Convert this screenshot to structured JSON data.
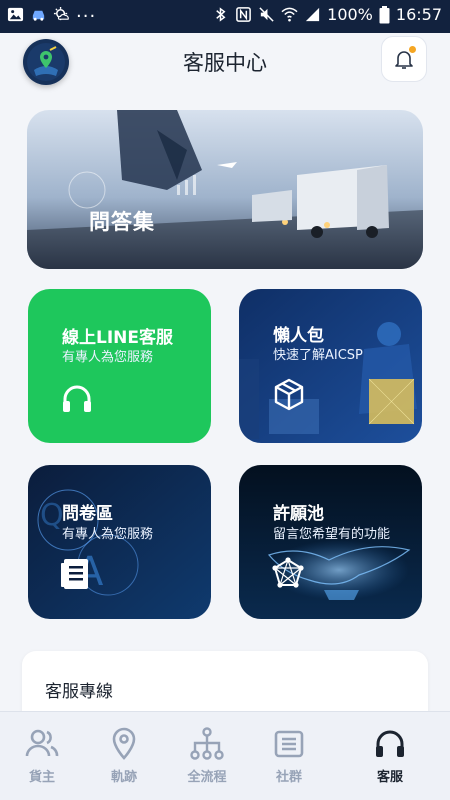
{
  "status_bar": {
    "battery": "100%",
    "time": "16:57",
    "dots": "..."
  },
  "header": {
    "title": "客服中心"
  },
  "cards": {
    "faq": {
      "label": "問答集"
    },
    "line": {
      "title": "線上LINE客服",
      "subtitle": "有專人為您服務"
    },
    "lazy": {
      "title": "懶人包",
      "subtitle": "快速了解AICSP"
    },
    "survey": {
      "title": "問卷區",
      "subtitle": "有專人為您服務"
    },
    "wish": {
      "title": "許願池",
      "subtitle": "留言您希望有的功能"
    }
  },
  "hotline": {
    "label": "客服專線"
  },
  "bottom_nav": {
    "items": [
      {
        "label": "貨主",
        "icon": "users-icon",
        "active": false
      },
      {
        "label": "軌跡",
        "icon": "location-pin-icon",
        "active": false
      },
      {
        "label": "全流程",
        "icon": "hierarchy-icon",
        "active": false
      },
      {
        "label": "社群",
        "icon": "list-icon",
        "active": false
      },
      {
        "label": "客服",
        "icon": "headphones-icon",
        "active": true
      }
    ]
  },
  "colors": {
    "line_green": "#1ec75c",
    "nav_active": "#1c2430",
    "nav_inactive": "#97a3b7",
    "status_bar": "#12223e"
  }
}
